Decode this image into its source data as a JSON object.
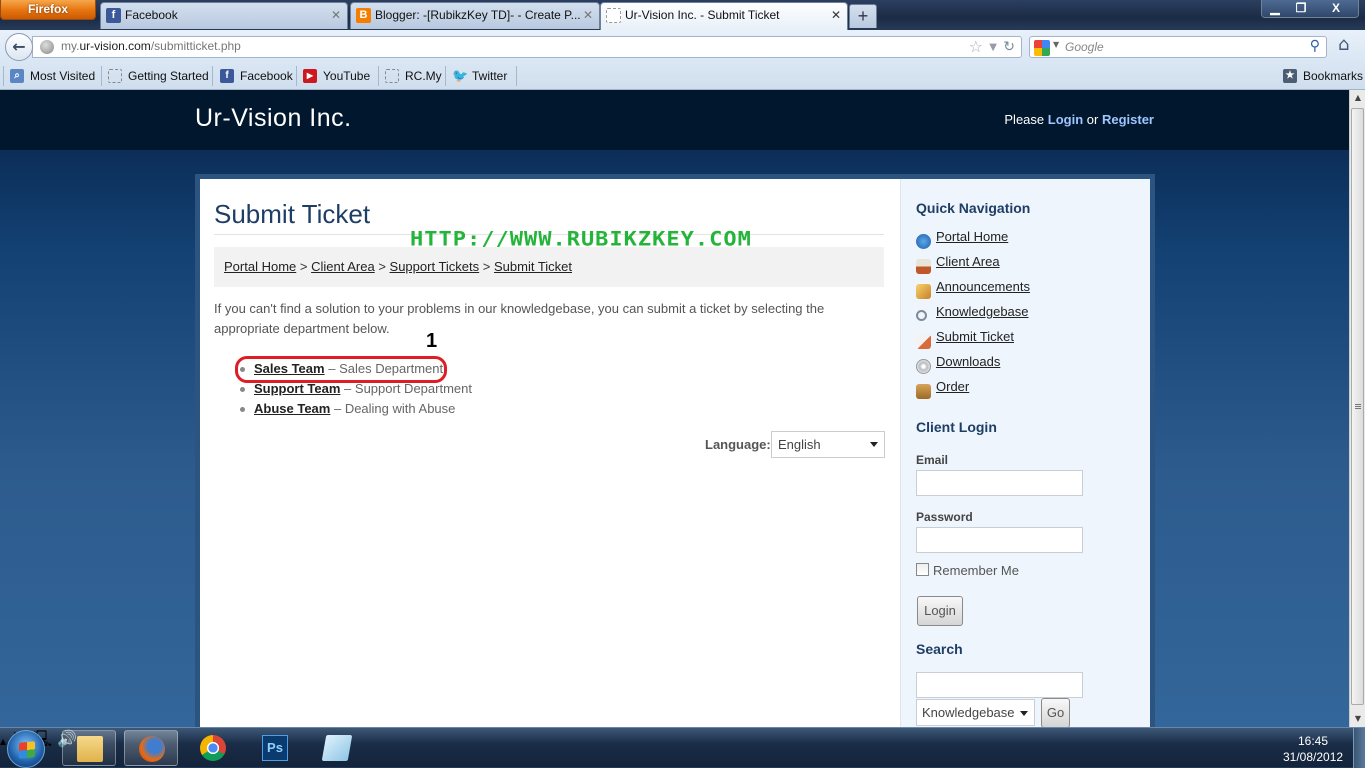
{
  "browser": {
    "menu_button": "Firefox",
    "tabs": [
      {
        "label": "Facebook",
        "icon": "facebook-icon",
        "active": false
      },
      {
        "label": "Blogger: -[RubikzKey TD]- - Create P...",
        "icon": "blogger-icon",
        "active": false
      },
      {
        "label": "Ur-Vision Inc. - Submit Ticket",
        "icon": "blank-page-icon",
        "active": true
      }
    ],
    "new_tab": "+",
    "window_controls": {
      "minimize": "▁",
      "maximize": "❐",
      "close": "X"
    },
    "url": {
      "prefix": "my.",
      "domain": "ur-vision.com",
      "path": "/submitticket.php"
    },
    "search": {
      "placeholder": "Google"
    },
    "bookmarks": [
      {
        "label": "Most Visited",
        "icon": "most-visited-icon"
      },
      {
        "label": "Getting Started",
        "icon": "blank-page-icon"
      },
      {
        "label": "Facebook",
        "icon": "facebook-icon"
      },
      {
        "label": "YouTube",
        "icon": "youtube-icon"
      },
      {
        "label": "RC.My",
        "icon": "blank-page-icon"
      },
      {
        "label": "Twitter",
        "icon": "twitter-icon"
      }
    ],
    "bookmarks_menu": "Bookmarks"
  },
  "site": {
    "title": "Ur-Vision Inc.",
    "login_prompt": {
      "please": "Please",
      "login": "Login",
      "or": "or",
      "register": "Register"
    },
    "colors": {
      "header_bg": "#00172e",
      "link_accent": "#9fc6ff",
      "heading": "#1f3e66"
    }
  },
  "main": {
    "page_title": "Submit Ticket",
    "watermark": "HTTP://WWW.RUBIKZKEY.COM",
    "breadcrumb": [
      {
        "label": "Portal Home"
      },
      {
        "label": "Client Area"
      },
      {
        "label": "Support Tickets"
      },
      {
        "label": "Submit Ticket"
      }
    ],
    "breadcrumb_separator": ">",
    "intro": "If you can't find a solution to your problems in our knowledgebase, you can submit a ticket by selecting the appropriate department below.",
    "departments": [
      {
        "name": "Sales Team",
        "desc": "Sales Department"
      },
      {
        "name": "Support Team",
        "desc": "Support Department"
      },
      {
        "name": "Abuse Team",
        "desc": "Dealing with Abuse"
      }
    ],
    "dept_separator": " – ",
    "annotation_number": "1",
    "language": {
      "label": "Language:",
      "selected": "English"
    }
  },
  "sidebar": {
    "quick_nav_title": "Quick Navigation",
    "quick_nav": [
      {
        "label": "Portal Home",
        "icon": "portal-home-icon",
        "color": "#1d6fc0"
      },
      {
        "label": "Client Area",
        "icon": "house-icon",
        "color": "#c0572a"
      },
      {
        "label": "Announcements",
        "icon": "announcements-icon",
        "color": "#e0a23c"
      },
      {
        "label": "Knowledgebase",
        "icon": "magnifier-icon",
        "color": "#8a97a6"
      },
      {
        "label": "Submit Ticket",
        "icon": "submit-ticket-icon",
        "color": "#d96b3c"
      },
      {
        "label": "Downloads",
        "icon": "cd-icon",
        "color": "#b9bcc2"
      },
      {
        "label": "Order",
        "icon": "box-icon",
        "color": "#b07a2e"
      }
    ],
    "client_login": {
      "title": "Client Login",
      "email_label": "Email",
      "email_value": "",
      "password_label": "Password",
      "password_value": "",
      "remember_label": "Remember Me",
      "remember_checked": false,
      "login_button": "Login"
    },
    "search": {
      "title": "Search",
      "query": "",
      "scope_selected": "Knowledgebase",
      "go_button": "Go"
    }
  },
  "taskbar": {
    "apps": [
      {
        "name": "windows-explorer",
        "icon": "folder-icon"
      },
      {
        "name": "firefox",
        "icon": "firefox-icon",
        "active": true
      },
      {
        "name": "chrome",
        "icon": "chrome-icon"
      },
      {
        "name": "photoshop",
        "icon": "photoshop-icon",
        "label": "Ps"
      },
      {
        "name": "notepad",
        "icon": "notepad-icon"
      }
    ],
    "clock": {
      "time": "16:45",
      "date": "31/08/2012"
    }
  }
}
